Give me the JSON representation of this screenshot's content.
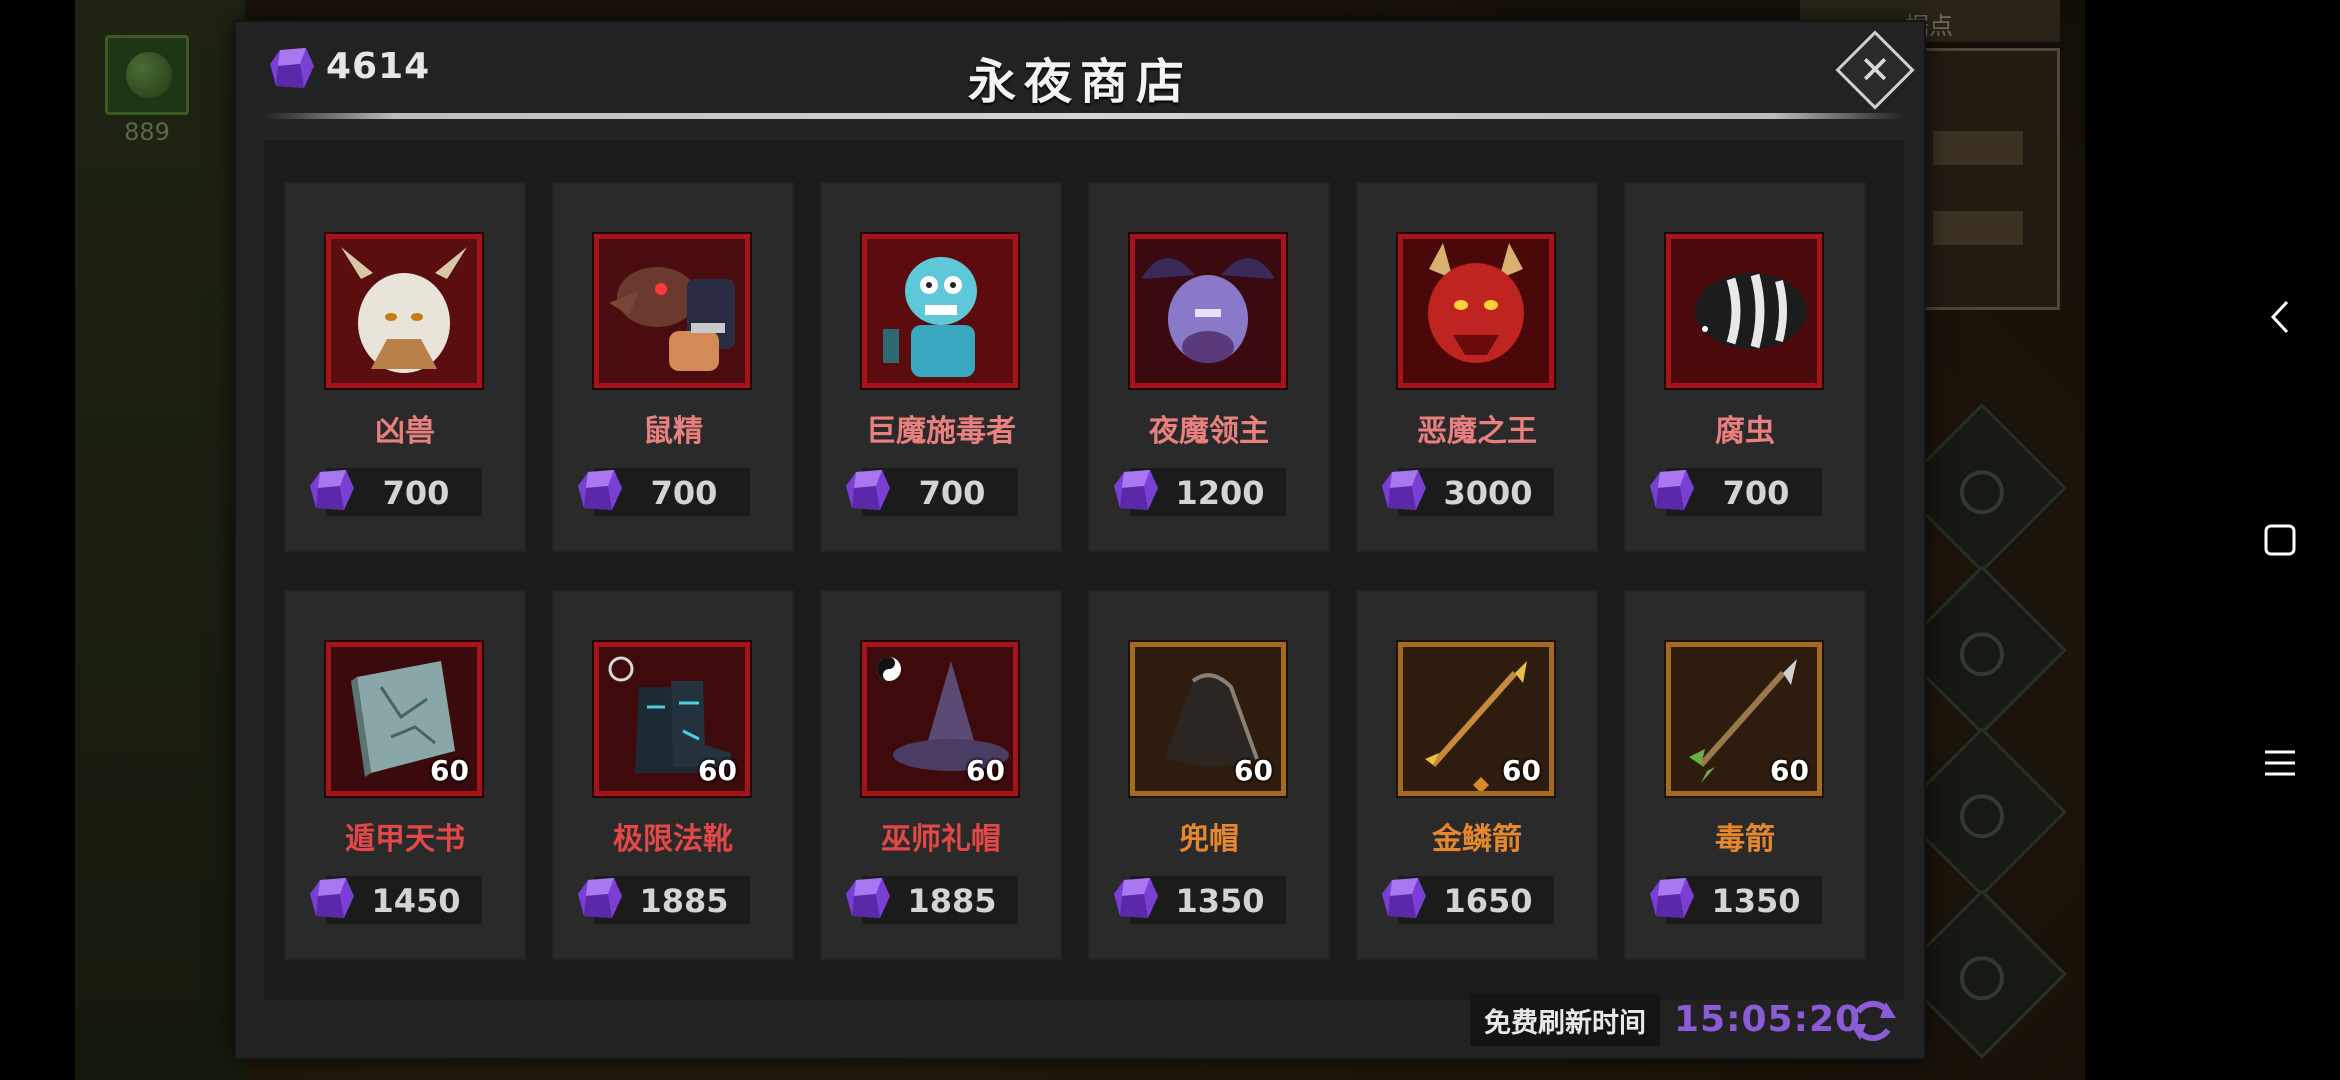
{
  "background": {
    "skill_count": "889",
    "top_right_label": "据点"
  },
  "header": {
    "currency_amount": "4614",
    "title": "永夜商店",
    "close_icon": "close-icon"
  },
  "items_row1": [
    {
      "name": "凶兽",
      "price": "700",
      "art": "white-horned-beast"
    },
    {
      "name": "鼠精",
      "price": "700",
      "art": "rat-warrior"
    },
    {
      "name": "巨魔施毒者",
      "price": "700",
      "art": "troll-poisoner"
    },
    {
      "name": "夜魔领主",
      "price": "1200",
      "art": "night-demon-lord"
    },
    {
      "name": "恶魔之王",
      "price": "3000",
      "art": "demon-king"
    },
    {
      "name": "腐虫",
      "price": "700",
      "art": "rot-worm"
    }
  ],
  "items_row2": [
    {
      "name": "遁甲天书",
      "price": "1450",
      "level": "60",
      "art": "stone-book"
    },
    {
      "name": "极限法靴",
      "price": "1885",
      "level": "60",
      "art": "magic-boots"
    },
    {
      "name": "巫师礼帽",
      "price": "1885",
      "level": "60",
      "art": "wizard-hat"
    },
    {
      "name": "兜帽",
      "price": "1350",
      "level": "60",
      "art": "hood"
    },
    {
      "name": "金鳞箭",
      "price": "1650",
      "level": "60",
      "art": "gold-arrow"
    },
    {
      "name": "毒箭",
      "price": "1350",
      "level": "60",
      "art": "poison-arrow"
    }
  ],
  "footer": {
    "refresh_label": "免费刷新时间",
    "refresh_time": "15:05:20"
  },
  "colors": {
    "gem": "#8a4fe0",
    "frame_red": "#a3141b",
    "frame_bronze": "#a56a21",
    "name_red": "#e34848",
    "name_orange": "#e5872e",
    "timer_purple": "#8b5cd6"
  }
}
